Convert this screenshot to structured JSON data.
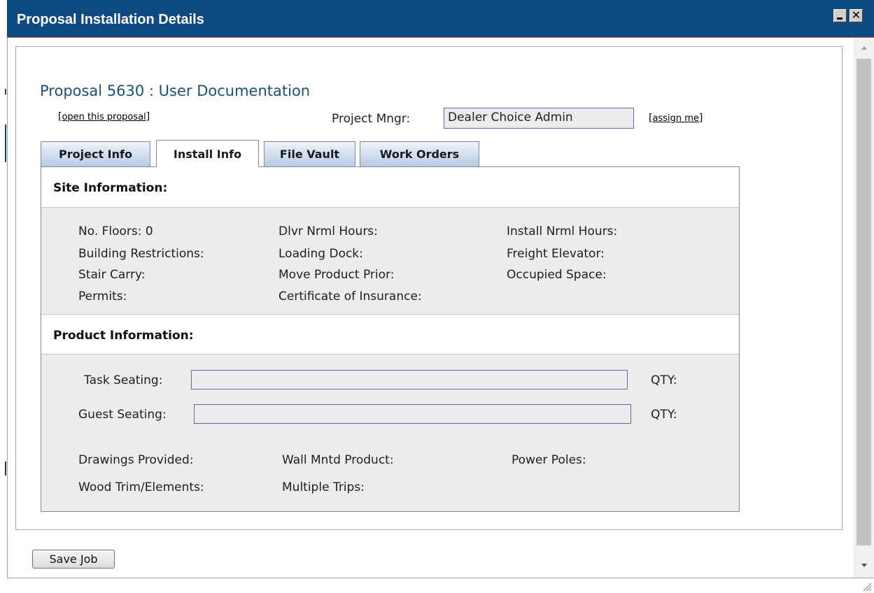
{
  "window": {
    "title": "Proposal Installation Details",
    "minimize_symbol": "_",
    "close_symbol": "✕"
  },
  "header": {
    "proposal_title": "Proposal 5630 : User Documentation",
    "open_link": "open this proposal",
    "project_manager_label": "Project Mngr:",
    "project_manager_value": "Dealer Choice Admin",
    "assign_link": "assign me"
  },
  "tabs": [
    {
      "label": "Project Info",
      "active": false
    },
    {
      "label": "Install Info",
      "active": true
    },
    {
      "label": "File Vault",
      "active": false
    },
    {
      "label": "Work Orders",
      "active": false
    }
  ],
  "site_information": {
    "heading": "Site Information:",
    "fields": [
      "No. Floors: 0",
      "Dlvr Nrml Hours:",
      "Install Nrml Hours:",
      "Building Restrictions:",
      "Loading Dock:",
      "Freight Elevator:",
      "Stair Carry:",
      "Move Product Prior:",
      "Occupied Space:",
      "Permits:",
      "Certificate of Insurance:"
    ]
  },
  "product_information": {
    "heading": "Product Information:",
    "task_seating_label": "Task Seating:",
    "task_seating_value": "",
    "task_qty_label": "QTY:",
    "guest_seating_label": "Guest Seating:",
    "guest_seating_value": "",
    "guest_qty_label": "QTY:",
    "fields": [
      "Drawings Provided:",
      "Wall Mntd Product:",
      "Power Poles:",
      "Wood Trim/Elements:",
      "Multiple Trips:"
    ]
  },
  "footer": {
    "save_button": "Save Job"
  },
  "colors": {
    "titlebar": "#0d4a84",
    "heading_text": "#1a4f7a",
    "content_background": "#ececec",
    "input_border": "#6a64a8"
  }
}
